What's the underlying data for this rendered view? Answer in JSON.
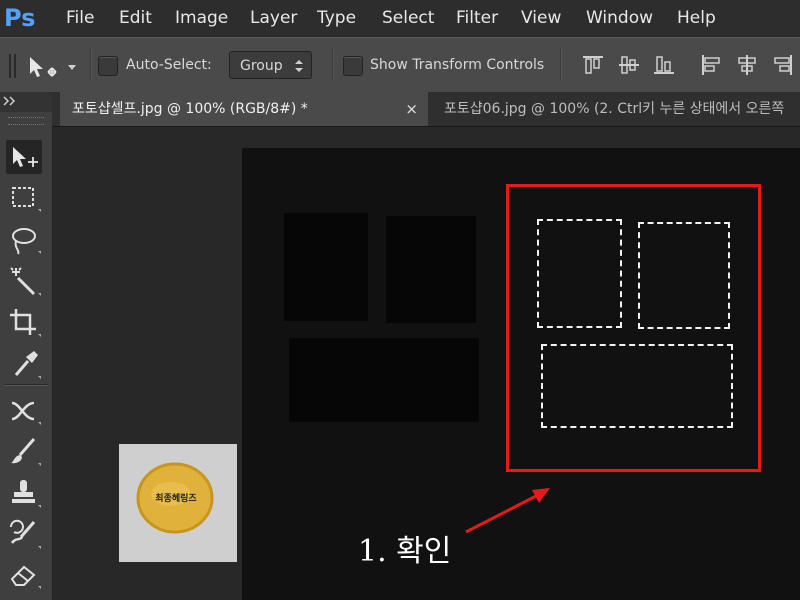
{
  "app": {
    "logo": "Ps"
  },
  "menubar": {
    "items": [
      "File",
      "Edit",
      "Image",
      "Layer",
      "Type",
      "Select",
      "Filter",
      "View",
      "Window",
      "Help"
    ]
  },
  "options_bar": {
    "auto_select_label": "Auto-Select:",
    "auto_select_checked": false,
    "auto_select_target": "Group",
    "show_transform_label": "Show Transform Controls",
    "show_transform_checked": false
  },
  "tabs": [
    {
      "label": "포토샵셀프.jpg @ 100% (RGB/8#) *",
      "active": true,
      "close": "×"
    },
    {
      "label": "포토샵06.jpg @ 100% (2. Ctrl키 누른 상태에서 오른쪽",
      "active": false
    }
  ],
  "tools": [
    "move-tool",
    "marquee-tool",
    "lasso-tool",
    "magic-wand-tool",
    "crop-tool",
    "eyedropper-tool",
    "healing-tool",
    "brush-tool",
    "stamp-tool",
    "history-brush-tool",
    "eraser-tool"
  ],
  "annotation": {
    "text": "1. 확인",
    "color": "#e51b1b"
  },
  "thumbnail": {
    "badge_text": "최종헤링즈"
  },
  "colors": {
    "highlight": "#e51b1b",
    "logo": "#4fa3ff",
    "panel": "#3f3f3f",
    "canvas": "#111111"
  }
}
